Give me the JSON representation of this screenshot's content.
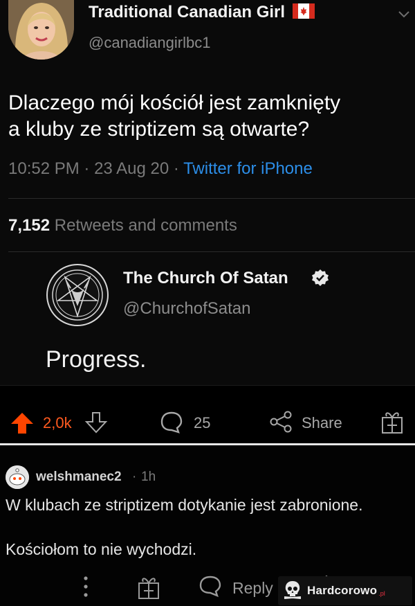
{
  "tweet": {
    "author_name": "Traditional Canadian Girl",
    "author_handle": "@canadiangirlbc1",
    "flag_icon": "canada-flag-icon",
    "text_line1": "Dlaczego mój kościół jest zamknięty",
    "text_line2": "a kluby ze striptizem są otwarte?",
    "time": "10:52 PM",
    "date": "23 Aug 20",
    "sep": "·",
    "source": "Twitter for iPhone",
    "retweet_count": "7,152",
    "retweet_label": "Retweets and comments"
  },
  "quoted": {
    "name": "The Church Of Satan",
    "handle": "@ChurchofSatan",
    "text": "Progress.",
    "verified_icon": "verified-badge-icon",
    "logo_icon": "pentagram-logo-icon"
  },
  "actions": {
    "score": "2,0k",
    "comments": "25",
    "share_label": "Share",
    "upvote_color": "#ff4500"
  },
  "comment": {
    "username": "welshmanec2",
    "dot": "·",
    "time": "1h",
    "line1": "W klubach ze striptizem dotykanie jest zabronione.",
    "line2": "Kościołom to nie wychodzi.",
    "reply_label": "Reply"
  },
  "watermark": {
    "text": "Hardcorowo",
    "tld": ".pl"
  }
}
